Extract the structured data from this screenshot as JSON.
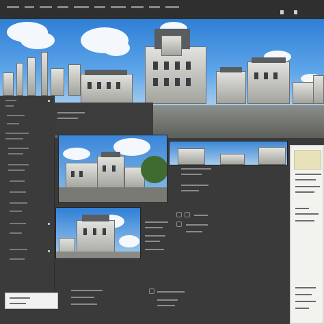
{
  "window": {
    "title": "",
    "top_icons": [
      "layers-icon",
      "window-icon"
    ]
  },
  "hero_image": {
    "subject": "castle-panorama-image"
  },
  "panels": {
    "left": {
      "name": "left-tools-panel"
    },
    "right": {
      "name": "properties-panel"
    }
  },
  "thumbnails": [
    {
      "name": "castle-thumbnail-1"
    },
    {
      "name": "castle-thumbnail-2"
    },
    {
      "name": "castle-thumbnail-3"
    }
  ],
  "colors": {
    "background": "#3a3a3a",
    "sky": "#2f7fd6",
    "panel_light": "#f2f2ef",
    "accent_yellow": "#e9e2b8"
  }
}
